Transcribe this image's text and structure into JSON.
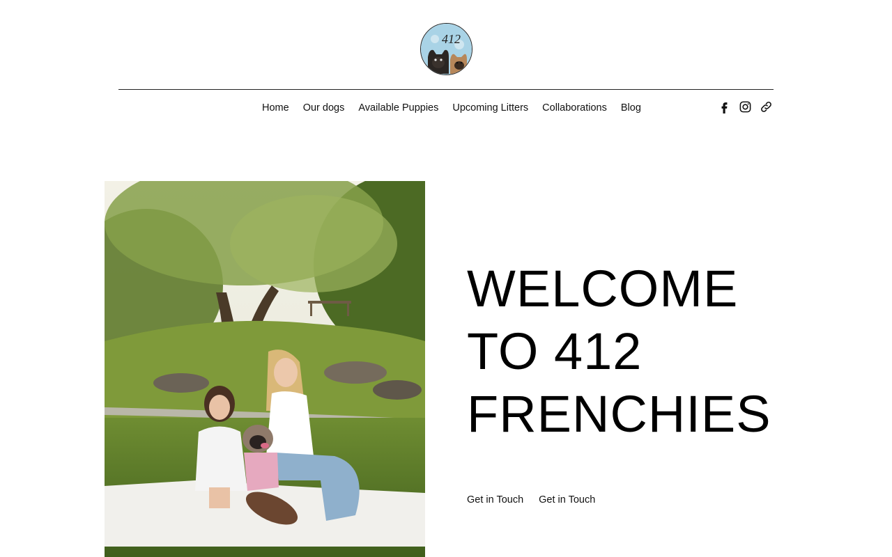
{
  "brand": {
    "logo_text": "412",
    "logo_icon": "french-bulldogs-logo-icon"
  },
  "nav": {
    "items": [
      {
        "label": "Home"
      },
      {
        "label": "Our dogs"
      },
      {
        "label": "Available Puppies"
      },
      {
        "label": "Upcoming Litters"
      },
      {
        "label": "Collaborations"
      },
      {
        "label": "Blog"
      }
    ]
  },
  "social": {
    "icons": [
      "facebook-icon",
      "instagram-icon",
      "link-icon"
    ]
  },
  "hero": {
    "image": "family-with-french-bulldog-photo",
    "title_lines": [
      "WELCOME",
      "TO 412",
      "FRENCHIES"
    ],
    "cta_primary": "Get in Touch",
    "cta_secondary": "Get in Touch"
  },
  "colors": {
    "text": "#000000",
    "background": "#ffffff",
    "logo_bg": "#a9d3e6"
  }
}
